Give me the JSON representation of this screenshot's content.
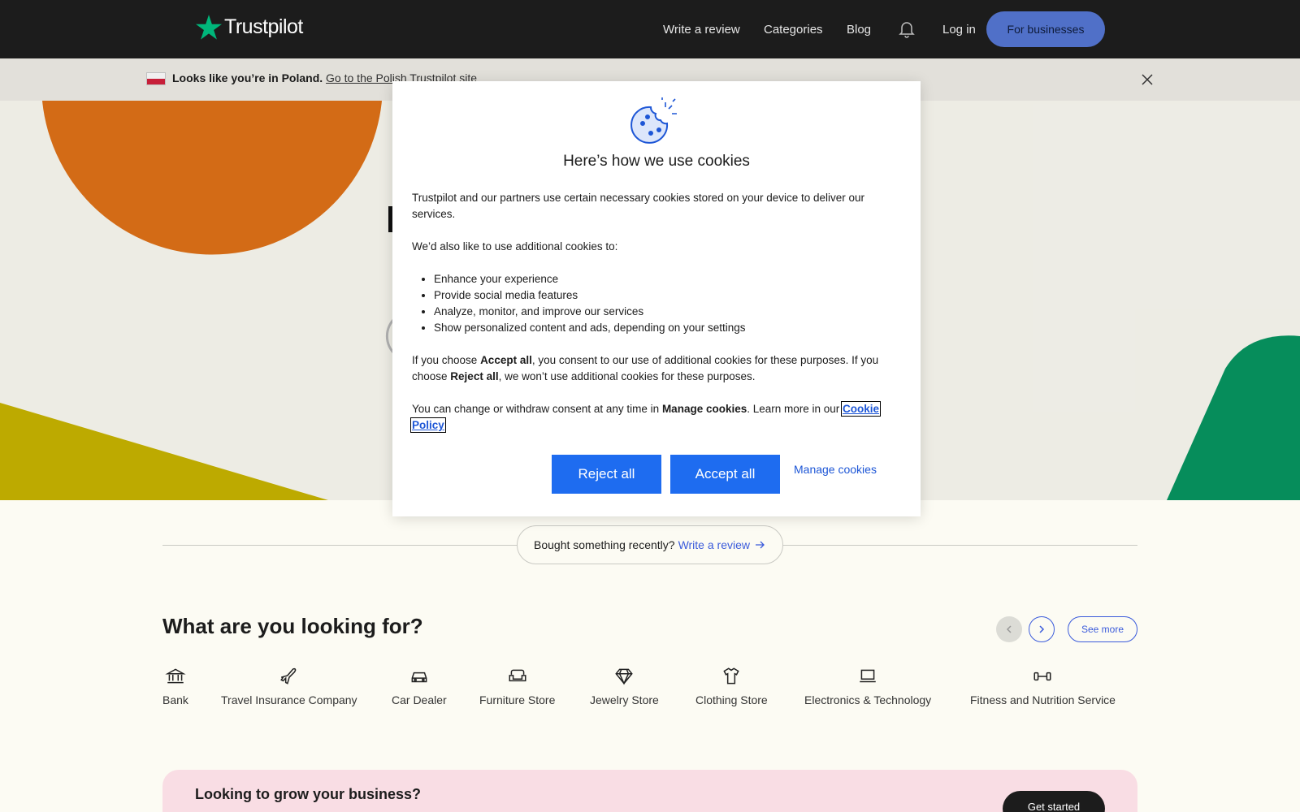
{
  "header": {
    "logo_text": "Trustpilot",
    "nav": [
      "Write a review",
      "Categories",
      "Blog"
    ],
    "login": "Log in",
    "for_businesses": "For businesses"
  },
  "banner": {
    "text": "Looks like you’re in Poland.",
    "link": "Go to the Polish Trustpilot site"
  },
  "cookie_modal": {
    "title": "Here’s how we use cookies",
    "p1": "Trustpilot and our partners use certain necessary cookies stored on your device to deliver our services.",
    "p2": "We’d also like to use additional cookies to:",
    "bullets": [
      "Enhance your experience",
      "Provide social media features",
      "Analyze, monitor, and improve our services",
      "Show personalized content and ads, depending on your settings"
    ],
    "p3_a": "If you choose ",
    "p3_b": "Accept all",
    "p3_c": ", you consent to our use of additional cookies for these purposes. If you choose ",
    "p3_d": "Reject all",
    "p3_e": ", we won’t use additional cookies for these purposes.",
    "p4_a": "You can change or withdraw consent at any time in ",
    "p4_b": "Manage cookies",
    "p4_c": ". Learn more in our ",
    "cookie_policy": "Cookie Policy",
    "reject_all": "Reject all",
    "accept_all": "Accept all",
    "manage_cookies": "Manage cookies"
  },
  "review_pill": {
    "text": "Bought something recently?",
    "link": "Write a review"
  },
  "categories": {
    "title": "What are you looking for?",
    "see_more": "See more",
    "items": [
      {
        "label": "Bank",
        "icon": "bank-icon"
      },
      {
        "label": "Travel Insurance Company",
        "icon": "plane-icon"
      },
      {
        "label": "Car Dealer",
        "icon": "car-icon"
      },
      {
        "label": "Furniture Store",
        "icon": "sofa-icon"
      },
      {
        "label": "Jewelry Store",
        "icon": "diamond-icon"
      },
      {
        "label": "Clothing Store",
        "icon": "shirt-icon"
      },
      {
        "label": "Electronics & Technology",
        "icon": "laptop-icon"
      },
      {
        "label": "Fitness and Nutrition Service",
        "icon": "dumbbell-icon"
      }
    ]
  },
  "business_banner": {
    "title": "Looking to grow your business?",
    "button": "Get started"
  },
  "colors": {
    "trustpilot_green": "#00b67a",
    "brand_blue": "#1e6cf0",
    "header_bg": "#1c1c1c"
  }
}
